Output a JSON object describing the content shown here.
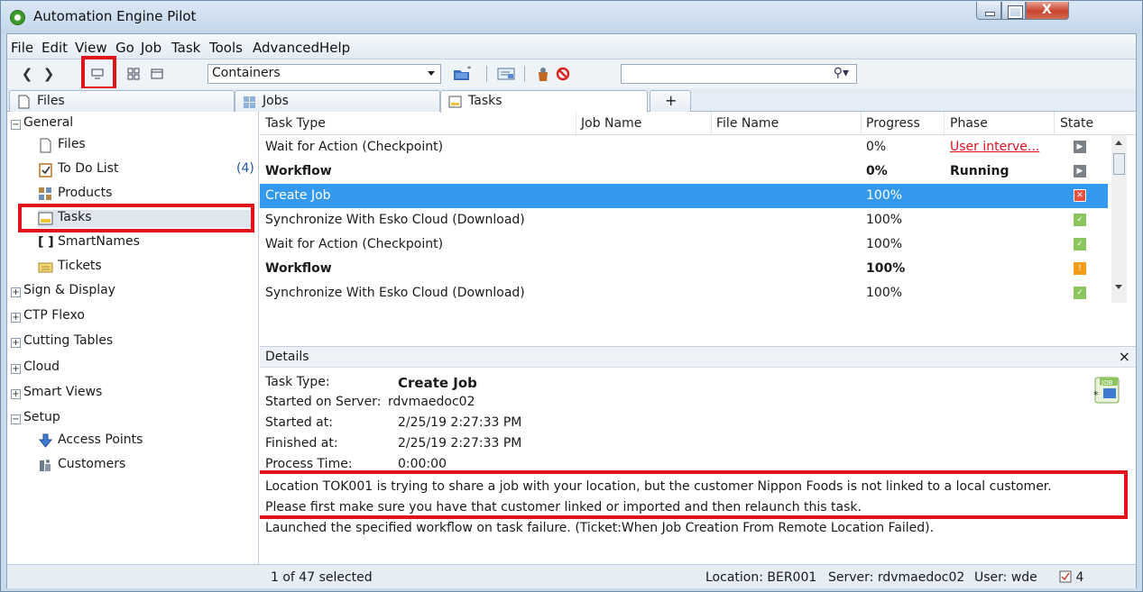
{
  "window": {
    "title": "Automation Engine Pilot",
    "accent_highlight": "#e0131d",
    "selection_color": "#3399ee"
  },
  "menu": {
    "items": [
      "File",
      "Edit",
      "View",
      "Go",
      "Job",
      "Task",
      "Tools",
      "Advanced",
      "Help"
    ]
  },
  "toolbar": {
    "view_selector": "Containers",
    "search_placeholder": "",
    "icons": [
      "back-icon",
      "forward-icon",
      "single-view-icon",
      "tile-view-icon",
      "panel-view-icon",
      "new-container-icon",
      "settings-icon",
      "launch-icon",
      "cancel-icon",
      "search-icon"
    ]
  },
  "tabs": [
    {
      "label": "Files"
    },
    {
      "label": "Jobs"
    },
    {
      "label": "Tasks"
    },
    {
      "label": "+"
    }
  ],
  "tree": {
    "general": "General",
    "files": "Files",
    "todo": "To Do List",
    "todo_count": "(4)",
    "products": "Products",
    "tasks": "Tasks",
    "smartnames": "SmartNames",
    "tickets": "Tickets",
    "sign_display": "Sign & Display",
    "ctp_flexo": "CTP Flexo",
    "cutting_tables": "Cutting Tables",
    "cloud": "Cloud",
    "smart_views": "Smart Views",
    "setup": "Setup",
    "access_points": "Access Points",
    "customers": "Customers"
  },
  "table": {
    "columns": [
      "Task Type",
      "Job Name",
      "File Name",
      "Progress",
      "Phase",
      "State"
    ],
    "rows": [
      {
        "task_type": "Wait for Action (Checkpoint)",
        "job_name": "",
        "file_name": "",
        "progress": "0%",
        "phase": "User interve...",
        "state": "pending"
      },
      {
        "task_type": "Workflow",
        "job_name": "",
        "file_name": "",
        "progress": "0%",
        "phase": "Running",
        "state": "pending"
      },
      {
        "task_type": "Create Job",
        "job_name": "",
        "file_name": "",
        "progress": "100%",
        "phase": "",
        "state": "error"
      },
      {
        "task_type": "Synchronize With Esko Cloud (Download)",
        "job_name": "",
        "file_name": "",
        "progress": "100%",
        "phase": "",
        "state": "ok"
      },
      {
        "task_type": "Wait for Action (Checkpoint)",
        "job_name": "",
        "file_name": "",
        "progress": "100%",
        "phase": "",
        "state": "ok"
      },
      {
        "task_type": "Workflow",
        "job_name": "",
        "file_name": "",
        "progress": "100%",
        "phase": "",
        "state": "warning"
      },
      {
        "task_type": "Synchronize With Esko Cloud (Download)",
        "job_name": "",
        "file_name": "",
        "progress": "100%",
        "phase": "",
        "state": "ok"
      }
    ]
  },
  "details": {
    "title": "Details",
    "close": "×",
    "task_type_label": "Task Type:",
    "task_type_value": "Create Job",
    "server_label": "Started on Server:",
    "server_value": "rdvmaedoc02",
    "started_label": "Started at:",
    "started_value": "2/25/19 2:27:33 PM",
    "finished_label": "Finished at:",
    "finished_value": "2/25/19 2:27:33 PM",
    "process_label": "Process Time:",
    "process_value": "0:00:00",
    "message_line1": "Location TOK001 is trying to share a job with your location, but the customer Nippon Foods is not linked to a local customer.",
    "message_line2": "Please first make sure you have that customer linked or imported  and then relaunch this task.",
    "message_line3": "Launched the specified workflow on task failure. (Ticket:When Job Creation From Remote Location Failed).",
    "job_icon_text": "JOB"
  },
  "status": {
    "selection": "1 of 47 selected",
    "location": "Location: BER001",
    "server": "Server: rdvmaedoc02",
    "user": "User: wde",
    "todo_count": "4"
  }
}
